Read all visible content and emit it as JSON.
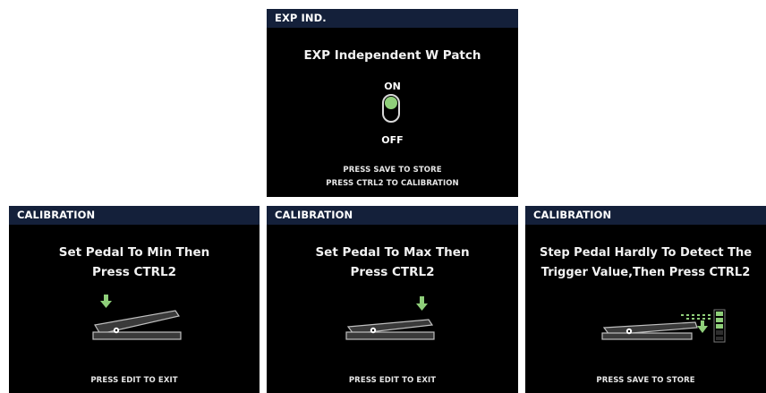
{
  "exp_ind": {
    "title": "EXP IND.",
    "heading": "EXP Independent W Patch",
    "toggle": {
      "on_label": "ON",
      "off_label": "OFF",
      "state": "ON"
    },
    "footer_line1": "PRESS SAVE TO STORE",
    "footer_line2": "PRESS CTRL2 TO CALIBRATION"
  },
  "calibration_screens": [
    {
      "title": "CALIBRATION",
      "line1": "Set Pedal To Min Then",
      "line2": "Press CTRL2",
      "footer": "PRESS EDIT TO EXIT",
      "pedal_position": "min"
    },
    {
      "title": "CALIBRATION",
      "line1": "Set Pedal To Max Then",
      "line2": "Press CTRL2",
      "footer": "PRESS EDIT TO EXIT",
      "pedal_position": "max"
    },
    {
      "title": "CALIBRATION",
      "line1": "Step Pedal Hardly To Detect The",
      "line2": "Trigger Value,Then Press CTRL2",
      "footer": "PRESS SAVE TO STORE",
      "pedal_position": "trigger"
    }
  ],
  "colors": {
    "title_bar": "#14203a",
    "accent_green": "#8fcf7a",
    "screen_bg": "#000000"
  }
}
